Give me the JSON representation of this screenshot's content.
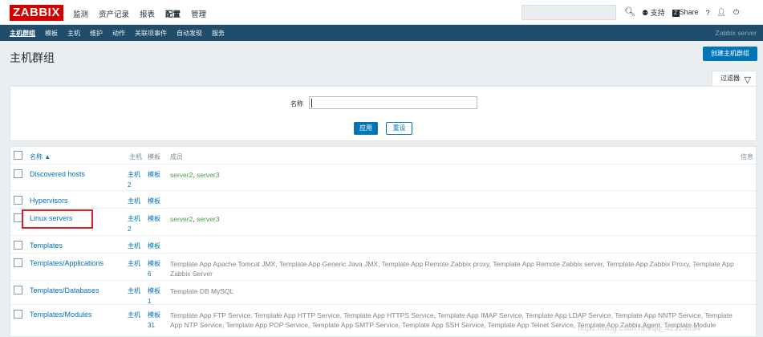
{
  "brand": "ZABBIX",
  "main_nav": [
    "监测",
    "资产记录",
    "报表",
    "配置",
    "管理"
  ],
  "main_nav_active": "配置",
  "search": {
    "placeholder": ""
  },
  "top_right": {
    "support": "支持",
    "share": "Share",
    "help": "?",
    "user_icon": "user-icon",
    "power_icon": "power-icon"
  },
  "sub_nav": [
    "主机群组",
    "模板",
    "主机",
    "维护",
    "动作",
    "关联项事件",
    "自动发现",
    "服务"
  ],
  "sub_nav_active": "主机群组",
  "server_label": "Zabbix server",
  "page": {
    "title": "主机群组",
    "create_button": "创建主机群组"
  },
  "filter": {
    "tab_label": "过滤器",
    "name_label": "名称",
    "name_value": "",
    "apply_label": "应用",
    "reset_label": "重设"
  },
  "table": {
    "headers": {
      "name": "名称 ▲",
      "hosts": "主机",
      "templates": "模板",
      "members": "成员",
      "info": "信息"
    },
    "rows": [
      {
        "name": "Discovered hosts",
        "hosts": "主机 2",
        "templates": "模板",
        "members": [
          [
            "server2",
            "green"
          ],
          [
            ", ",
            "plain"
          ],
          [
            "server3",
            "green"
          ]
        ]
      },
      {
        "name": "Hypervisors",
        "hosts": "主机",
        "templates": "模板",
        "members": []
      },
      {
        "name": "Linux servers",
        "hosts": "主机 2",
        "templates": "模板",
        "members": [
          [
            "server2",
            "green"
          ],
          [
            ", ",
            "plain"
          ],
          [
            "server3",
            "green"
          ]
        ]
      },
      {
        "name": "Templates",
        "hosts": "主机",
        "templates": "模板",
        "members": []
      },
      {
        "name": "Templates/Applications",
        "hosts": "主机",
        "templates": "模板 6",
        "members": [
          [
            "Template App Apache Tomcat JMX, Template App Generic Java JMX, Template App Remote Zabbix proxy, Template App Remote Zabbix server, Template App Zabbix Proxy, Template App Zabbix Server",
            "tpl"
          ]
        ]
      },
      {
        "name": "Templates/Databases",
        "hosts": "主机",
        "templates": "模板 1",
        "members": [
          [
            "Template DB MySQL",
            "tpl"
          ]
        ]
      },
      {
        "name": "Templates/Modules",
        "hosts": "主机",
        "templates": "模板 31",
        "members": [
          [
            "Template App FTP Service, Template App HTTP Service, Template App HTTPS Service, Template App IMAP Service, Template App LDAP Service, Template App NNTP Service, Template App NTP Service, Template App POP Service, Template App SMTP Service, Template App SSH Service, Template App Telnet Service, Template App Zabbix Agent, Template Module",
            "tpl"
          ]
        ]
      }
    ]
  },
  "watermark": "https://blog.csdn.net/qq_42124894",
  "colors": {
    "brand": "#d40000",
    "subnav": "#1f4d6b",
    "link": "#0275b8",
    "member_host": "#429e47",
    "highlight": "#e02020"
  }
}
